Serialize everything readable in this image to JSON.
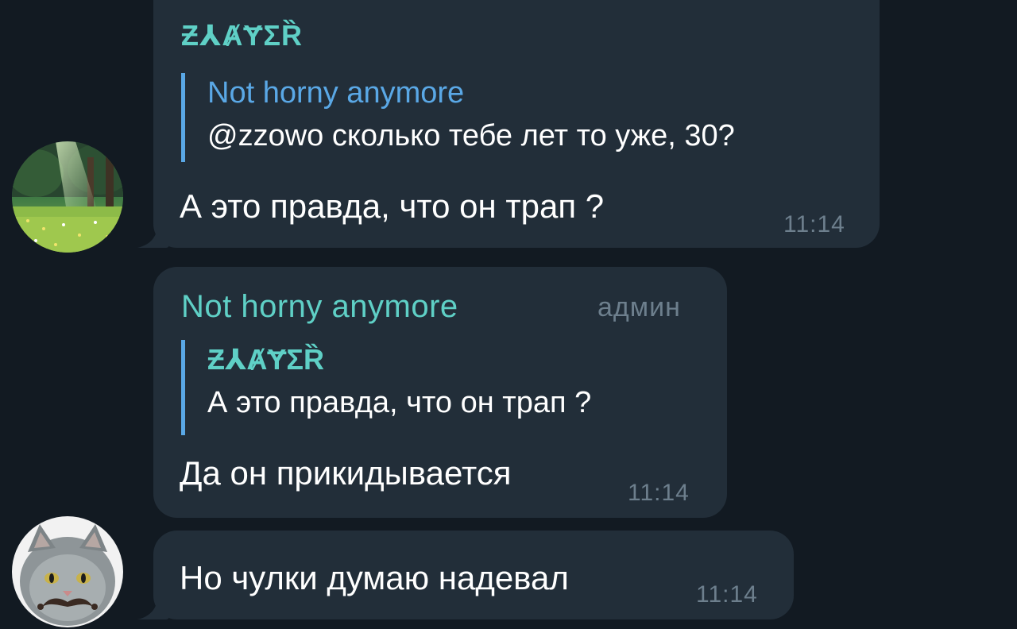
{
  "messages": [
    {
      "sender": "Ƶ⅄ȺɎƩȐ",
      "reply": {
        "name": "Not horny anymore",
        "text": "@zzowo сколько тебе лет то уже, 30?"
      },
      "text": "А это правда, что он трап ?",
      "time": "11:14"
    },
    {
      "sender": "Not horny anymore",
      "role": "админ",
      "reply": {
        "name": "Ƶ⅄ȺɎƩȐ",
        "text": "А это правда, что он трап ?"
      },
      "text": "Да он прикидывается",
      "time": "11:14"
    },
    {
      "text": "Но чулки думаю надевал",
      "time": "11:14"
    }
  ],
  "avatars": {
    "first": "forest-meadow-avatar",
    "second": "cat-with-mustache-avatar"
  }
}
